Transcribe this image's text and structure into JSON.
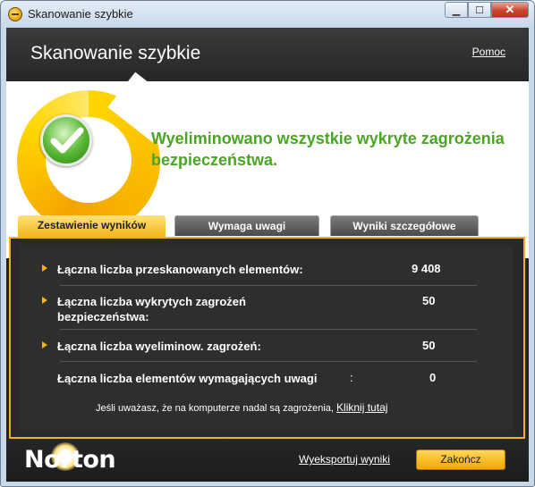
{
  "window": {
    "title": "Skanowanie szybkie",
    "controls": {
      "minimize": "▁",
      "maximize": "☐",
      "close": "✕"
    }
  },
  "header": {
    "title": "Skanowanie szybkie",
    "help": "Pomoc"
  },
  "hero": {
    "message": "Wyeliminowano wszystkie wykryte zagrożenia bezpieczeństwa.",
    "status_icon": "green-checkmark-icon",
    "accent_color": "#4aa524"
  },
  "tabs": [
    {
      "label": "Zestawienie wyników",
      "active": true
    },
    {
      "label": "Wymaga uwagi",
      "active": false
    },
    {
      "label": "Wyniki szczegółowe",
      "active": false
    }
  ],
  "summary": {
    "rows": [
      {
        "label": "Łączna liczba przeskanowanych elementów:",
        "value": "9 408"
      },
      {
        "label": "Łączna liczba wykrytych zagrożeń bezpieczeństwa:",
        "value": "50"
      },
      {
        "label": "Łączna liczba wyeliminow. zagrożeń:",
        "value": "50"
      },
      {
        "label": "Łączna liczba elementów wymagających uwagi",
        "colon": ":",
        "value": "0"
      }
    ],
    "note_text": "Jeśli uważasz, że na komputerze nadal są zagrożenia,",
    "note_link": "Kliknij tutaj"
  },
  "footer": {
    "brand": "Norton",
    "export_link": "Wyeksportuj wyniki",
    "finish_button": "Zakończ"
  },
  "colors": {
    "tab_active": "#f3b51a",
    "panel_border": "#f2b11a",
    "header_bg": "#262626"
  }
}
